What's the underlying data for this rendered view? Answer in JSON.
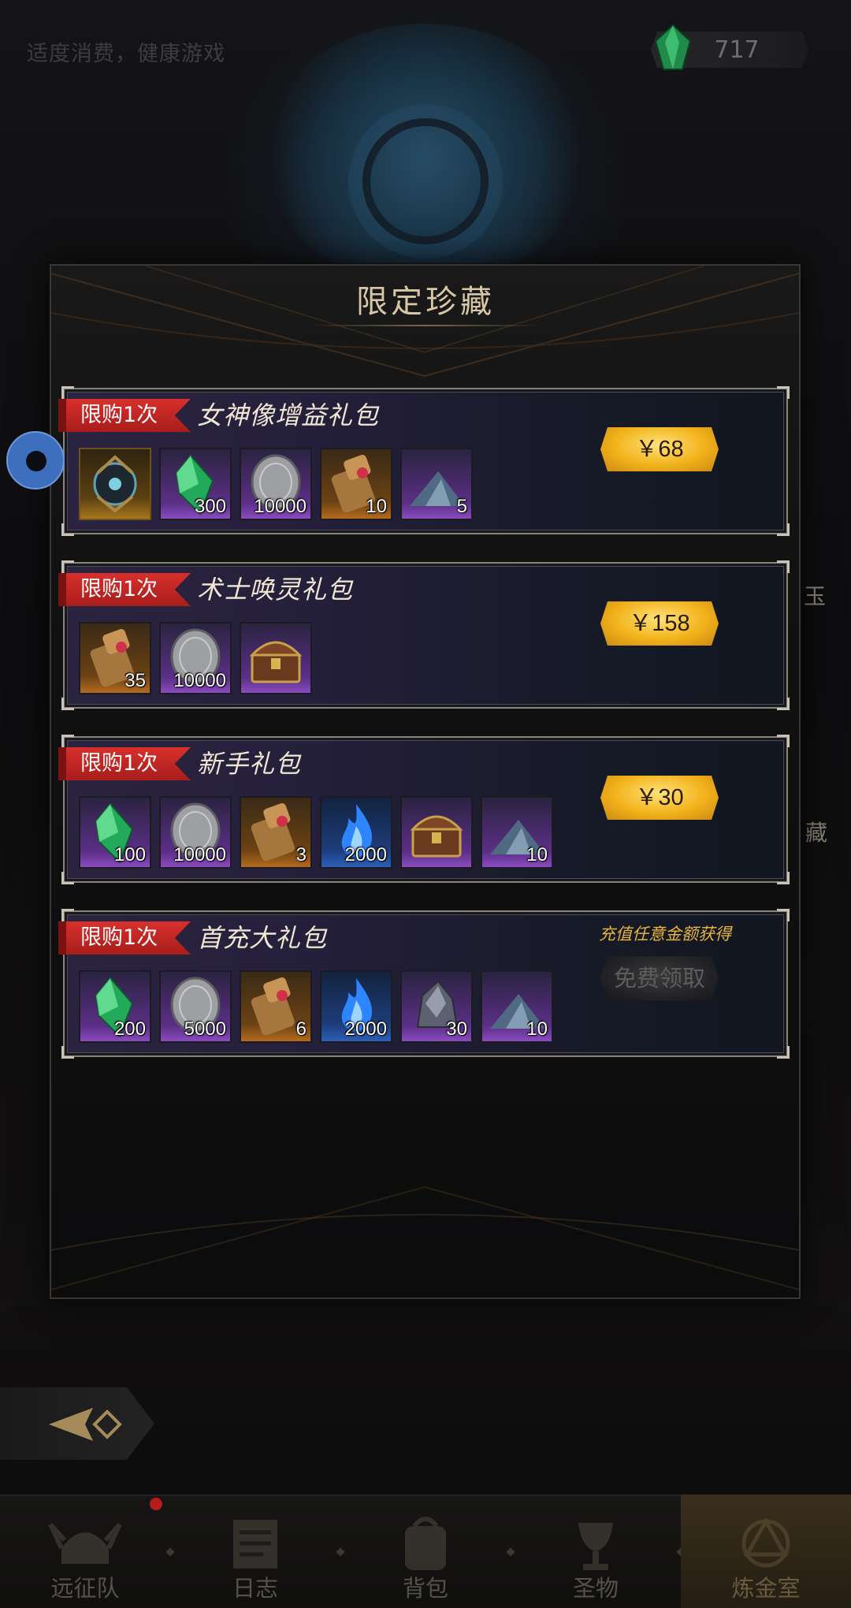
{
  "header": {
    "hint": "适度消费，健康游戏",
    "currency": {
      "icon": "green-gem-icon",
      "value": "717"
    }
  },
  "side_peek": {
    "right_top": "玉",
    "right_bottom": "藏"
  },
  "modal": {
    "title": "限定珍藏",
    "packs": [
      {
        "tag": "限购1次",
        "name": "女神像增益礼包",
        "action": {
          "type": "price",
          "label": "￥68"
        },
        "items": [
          {
            "icon": "goddess-statue-icon",
            "qty": "",
            "rarity": "gold"
          },
          {
            "icon": "green-crystal-icon",
            "qty": "300",
            "rarity": "purple"
          },
          {
            "icon": "silver-coin-icon",
            "qty": "10000",
            "rarity": "purple"
          },
          {
            "icon": "scroll-icon",
            "qty": "10",
            "rarity": "orange"
          },
          {
            "icon": "ore-pile-icon",
            "qty": "5",
            "rarity": "purple"
          }
        ]
      },
      {
        "tag": "限购1次",
        "name": "术士唤灵礼包",
        "action": {
          "type": "price",
          "label": "￥158"
        },
        "items": [
          {
            "icon": "scroll-icon",
            "qty": "35",
            "rarity": "orange"
          },
          {
            "icon": "silver-coin-icon",
            "qty": "10000",
            "rarity": "purple"
          },
          {
            "icon": "treasure-chest-icon",
            "qty": "",
            "rarity": "purple"
          }
        ]
      },
      {
        "tag": "限购1次",
        "name": "新手礼包",
        "action": {
          "type": "price",
          "label": "￥30"
        },
        "items": [
          {
            "icon": "green-crystal-icon",
            "qty": "100",
            "rarity": "purple"
          },
          {
            "icon": "silver-coin-icon",
            "qty": "10000",
            "rarity": "purple"
          },
          {
            "icon": "scroll-icon",
            "qty": "3",
            "rarity": "orange"
          },
          {
            "icon": "blue-flame-icon",
            "qty": "2000",
            "rarity": "blue"
          },
          {
            "icon": "treasure-chest-icon",
            "qty": "",
            "rarity": "purple"
          },
          {
            "icon": "ore-pile-icon",
            "qty": "10",
            "rarity": "purple"
          }
        ]
      },
      {
        "tag": "限购1次",
        "name": "首充大礼包",
        "note": "充值任意金额获得",
        "action": {
          "type": "free",
          "label": "免费领取"
        },
        "items": [
          {
            "icon": "green-crystal-icon",
            "qty": "200",
            "rarity": "purple"
          },
          {
            "icon": "silver-coin-icon",
            "qty": "5000",
            "rarity": "purple"
          },
          {
            "icon": "scroll-icon",
            "qty": "6",
            "rarity": "orange"
          },
          {
            "icon": "blue-flame-icon",
            "qty": "2000",
            "rarity": "blue"
          },
          {
            "icon": "iron-ore-icon",
            "qty": "30",
            "rarity": "purple"
          },
          {
            "icon": "ore-pile-icon",
            "qty": "10",
            "rarity": "purple"
          }
        ]
      }
    ]
  },
  "nav": {
    "items": [
      {
        "label": "远征队",
        "icon": "viking-helmet-icon"
      },
      {
        "label": "日志",
        "icon": "journal-icon"
      },
      {
        "label": "背包",
        "icon": "backpack-icon"
      },
      {
        "label": "圣物",
        "icon": "chalice-icon"
      },
      {
        "label": "炼金室",
        "icon": "alchemy-icon"
      }
    ],
    "active_index": 4
  }
}
